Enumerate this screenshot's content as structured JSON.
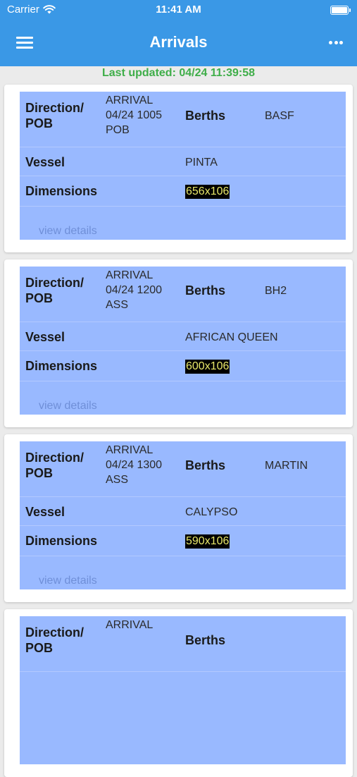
{
  "status_bar": {
    "carrier": "Carrier",
    "time": "11:41 AM"
  },
  "nav": {
    "title": "Arrivals"
  },
  "last_updated": "Last updated: 04/24 11:39:58",
  "labels": {
    "direction": "Direction/ POB",
    "berths": "Berths",
    "vessel": "Vessel",
    "dimensions": "Dimensions",
    "view_details": "view details"
  },
  "arrivals": [
    {
      "direction": "ARRIVAL",
      "datetime": "04/24 1005",
      "code": "POB",
      "berth": "BASF",
      "vessel": "PINTA",
      "dimensions": "656x106"
    },
    {
      "direction": "ARRIVAL",
      "datetime": "04/24 1200",
      "code": "ASS",
      "berth": "BH2",
      "vessel": "AFRICAN QUEEN",
      "dimensions": "600x106"
    },
    {
      "direction": "ARRIVAL",
      "datetime": "04/24 1300",
      "code": "ASS",
      "berth": "MARTIN",
      "vessel": "CALYPSO",
      "dimensions": "590x106"
    },
    {
      "direction": "ARRIVAL"
    }
  ]
}
